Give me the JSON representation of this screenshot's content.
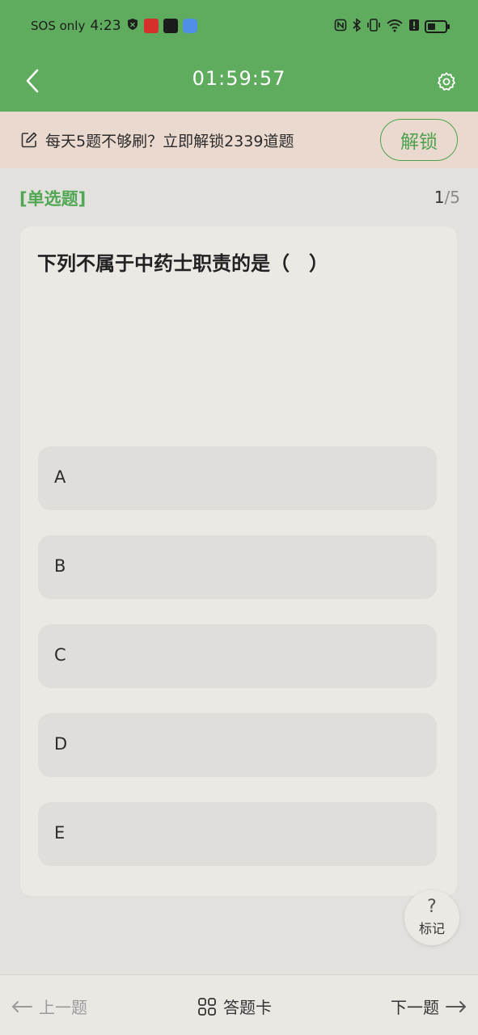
{
  "status_bar": {
    "carrier": "SOS only",
    "time": "4:23"
  },
  "header": {
    "timer": "01:59:57",
    "back_icon": "chevron-left-icon",
    "settings_icon": "gear-icon"
  },
  "banner": {
    "text": "每天5题不够刷？立即解锁2339道题",
    "unlock_label": "解锁",
    "icon": "edit-icon"
  },
  "question": {
    "type": "[单选题]",
    "current": "1",
    "separator": "/",
    "total": "5",
    "text": "下列不属于中药士职责的是（　）",
    "options": [
      {
        "label": "A"
      },
      {
        "label": "B"
      },
      {
        "label": "C"
      },
      {
        "label": "D"
      },
      {
        "label": "E"
      }
    ]
  },
  "mark": {
    "icon_text": "?",
    "label": "标记"
  },
  "bottom_nav": {
    "prev_label": "上一题",
    "answer_card_label": "答题卡",
    "next_label": "下一题"
  },
  "colors": {
    "header_green": "#5fac5e",
    "accent_green": "#4ea24e",
    "banner_bg": "#ead9cf"
  }
}
